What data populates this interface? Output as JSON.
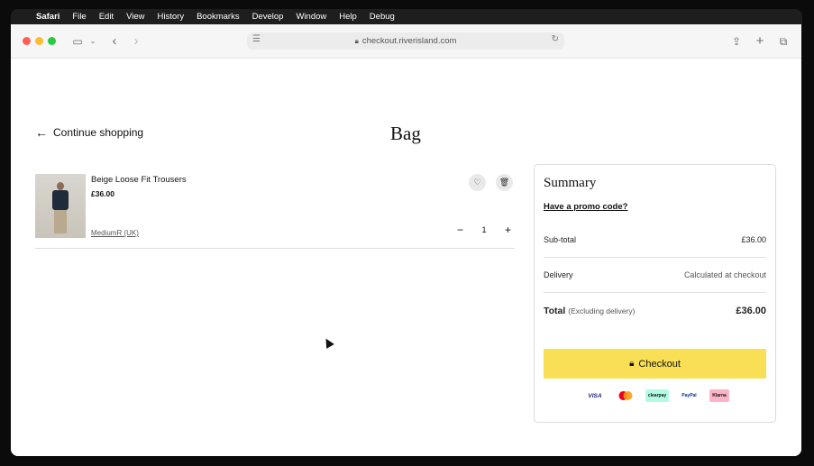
{
  "menubar": {
    "apple": "",
    "items": [
      "Safari",
      "File",
      "Edit",
      "View",
      "History",
      "Bookmarks",
      "Develop",
      "Window",
      "Help",
      "Debug"
    ]
  },
  "browser": {
    "url": "checkout.riverisland.com"
  },
  "page": {
    "continue_label": "Continue shopping",
    "title": "Bag",
    "item": {
      "name": "Beige Loose Fit Trousers",
      "price": "£36.00",
      "size": "MediumR (UK)",
      "quantity": "1",
      "minus": "−",
      "plus": "+"
    },
    "summary": {
      "title": "Summary",
      "promo": "Have a promo code?",
      "subtotal_label": "Sub-total",
      "subtotal_value": "£36.00",
      "delivery_label": "Delivery",
      "delivery_value": "Calculated at checkout",
      "total_label": "Total",
      "total_note": "(Excluding delivery)",
      "total_value": "£36.00",
      "checkout_label": "Checkout",
      "payments": [
        "VISA",
        "",
        "clearpay",
        "PayPal",
        "Klarna"
      ]
    }
  },
  "colors": {
    "checkout_bg": "#f8df55",
    "clearpay": "#b2fce4",
    "klarna": "#ffb3c7",
    "mastercard_red": "#eb001b",
    "mastercard_orange": "#f79e1b"
  },
  "icons": {
    "back": "arrow-left-icon",
    "wishlist": "heart-icon",
    "delete": "trash-icon",
    "lock": "lock-icon"
  }
}
